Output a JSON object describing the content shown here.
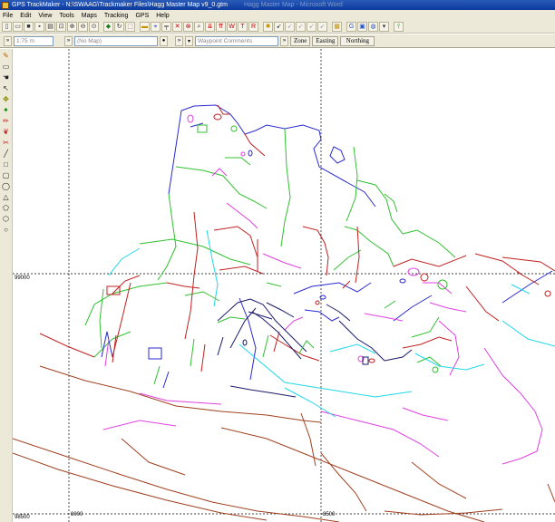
{
  "window": {
    "title": "GPS TrackMaker - N:\\SWAAG\\Trackmaker Files\\Hagg Master Map v9_0.gtm",
    "ghost_title": "Hagg Master Map - Microsoft Word"
  },
  "menu": [
    "File",
    "Edit",
    "View",
    "Tools",
    "Maps",
    "Tracking",
    "GPS",
    "Help"
  ],
  "toolbar": {
    "scale": "1:75 m",
    "map_select": "(No Map)",
    "waypoint_comments": "Waypoint Comments",
    "zone_label": "Zone",
    "easting_label": "Easting",
    "northing_label": "Northing"
  },
  "grid": {
    "y_label_mid": "99000",
    "y_label_bottom": "98500",
    "x_label_left": "8000",
    "x_label_right": "8500"
  },
  "colors": {
    "grid": "#000000",
    "blue": "#2a2ad0",
    "green": "#30c030",
    "red": "#c02020",
    "magenta": "#e040e0",
    "cyan": "#20d8e8",
    "brown": "#a04020",
    "navy": "#1a1a6a"
  }
}
